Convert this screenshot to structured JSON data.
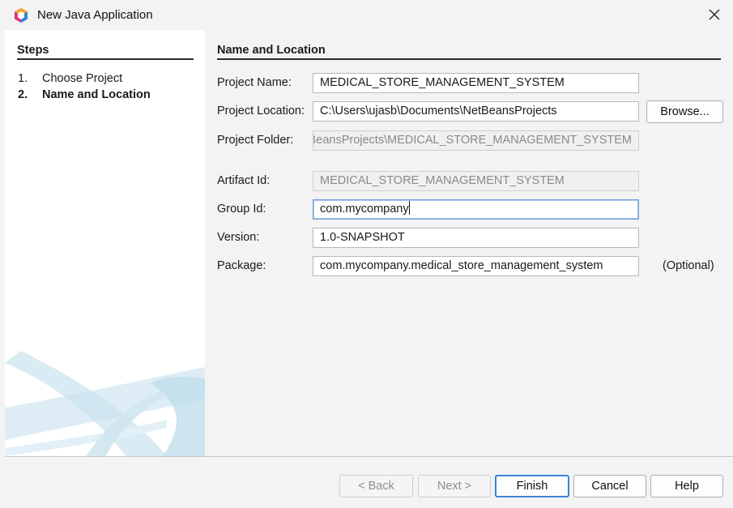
{
  "window": {
    "title": "New Java Application"
  },
  "steps": {
    "title": "Steps",
    "items": [
      {
        "num": "1.",
        "label": "Choose Project",
        "active": false
      },
      {
        "num": "2.",
        "label": "Name and Location",
        "active": true
      }
    ]
  },
  "main": {
    "section_title": "Name and Location",
    "fields": {
      "project_name": {
        "label": "Project Name:",
        "value": "MEDICAL_STORE_MANAGEMENT_SYSTEM"
      },
      "project_location": {
        "label": "Project Location:",
        "value": "C:\\Users\\ujasb\\Documents\\NetBeansProjects"
      },
      "project_folder": {
        "label": "Project Folder:",
        "value": "C:\\Users\\ujasb\\Documents\\NetBeansProjects\\MEDICAL_STORE_MANAGEMENT_SYSTEM"
      },
      "artifact_id": {
        "label": "Artifact Id:",
        "value": "MEDICAL_STORE_MANAGEMENT_SYSTEM"
      },
      "group_id": {
        "label": "Group Id:",
        "value": "com.mycompany"
      },
      "version": {
        "label": "Version:",
        "value": "1.0-SNAPSHOT"
      },
      "package": {
        "label": "Package:",
        "value": "com.mycompany.medical_store_management_system",
        "note": "(Optional)"
      }
    },
    "browse_label": "Browse..."
  },
  "buttons": {
    "back": "< Back",
    "next": "Next >",
    "finish": "Finish",
    "cancel": "Cancel",
    "help": "Help"
  },
  "colors": {
    "background": "#f3f3f3",
    "panel": "#ffffff",
    "focus_border": "#6a9ed6",
    "default_button_border": "#3b82d8"
  },
  "icons": {
    "app": "netbeans-logo-icon",
    "close": "close-icon"
  }
}
